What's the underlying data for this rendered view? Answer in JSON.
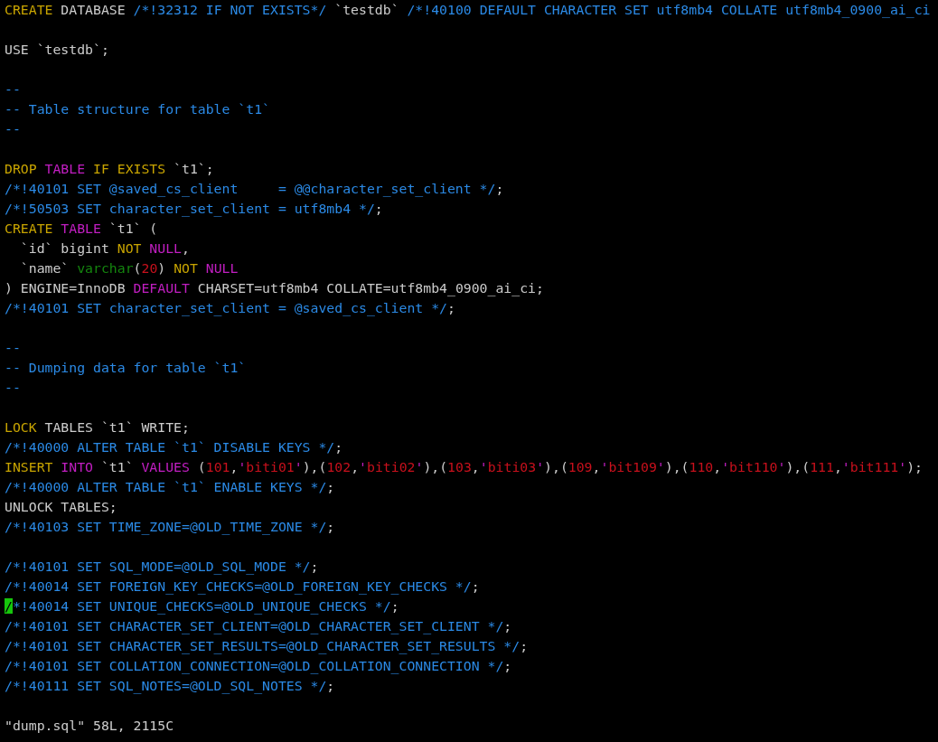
{
  "blocks": [
    [
      [
        {
          "text": "CREATE",
          "kind": "keyword"
        },
        {
          "text": " DATABASE ",
          "kind": "plain"
        },
        {
          "text": "/*!32312 IF NOT EXISTS*/",
          "kind": "comment"
        },
        {
          "text": " `testdb` ",
          "kind": "plain"
        },
        {
          "text": "/*!40100 DEFAULT CHARACTER SET utf8mb4 COLLATE utf8mb4_0900_ai_ci",
          "kind": "comment"
        }
      ]
    ],
    [
      [
        {
          "text": "USE `testdb`;",
          "kind": "plain"
        }
      ]
    ],
    [
      [
        {
          "text": "--",
          "kind": "comment"
        }
      ],
      [
        {
          "text": "-- Table structure for table `t1`",
          "kind": "comment"
        }
      ],
      [
        {
          "text": "--",
          "kind": "comment"
        }
      ]
    ],
    [
      [
        {
          "text": "DROP ",
          "kind": "keyword"
        },
        {
          "text": "TABLE ",
          "kind": "statement"
        },
        {
          "text": "IF EXISTS",
          "kind": "keyword"
        },
        {
          "text": " `t1`;",
          "kind": "plain"
        }
      ],
      [
        {
          "text": "/*!40101 SET @saved_cs_client     = @@character_set_client */",
          "kind": "comment"
        },
        {
          "text": ";",
          "kind": "plain"
        }
      ],
      [
        {
          "text": "/*!50503 SET character_set_client = utf8mb4 */",
          "kind": "comment"
        },
        {
          "text": ";",
          "kind": "plain"
        }
      ],
      [
        {
          "text": "CREATE ",
          "kind": "keyword"
        },
        {
          "text": "TABLE",
          "kind": "statement"
        },
        {
          "text": " `t1` (",
          "kind": "plain"
        }
      ],
      [
        {
          "text": "  `id` bigint ",
          "kind": "plain"
        },
        {
          "text": "NOT ",
          "kind": "keyword"
        },
        {
          "text": "NULL",
          "kind": "statement"
        },
        {
          "text": ",",
          "kind": "plain"
        }
      ],
      [
        {
          "text": "  `name` ",
          "kind": "plain"
        },
        {
          "text": "varchar",
          "kind": "type"
        },
        {
          "text": "(",
          "kind": "plain"
        },
        {
          "text": "20",
          "kind": "number"
        },
        {
          "text": ") ",
          "kind": "plain"
        },
        {
          "text": "NOT ",
          "kind": "keyword"
        },
        {
          "text": "NULL",
          "kind": "statement"
        }
      ],
      [
        {
          "text": ") ENGINE=InnoDB ",
          "kind": "plain"
        },
        {
          "text": "DEFAULT",
          "kind": "statement"
        },
        {
          "text": " CHARSET=utf8mb4 COLLATE=utf8mb4_0900_ai_ci;",
          "kind": "plain"
        }
      ],
      [
        {
          "text": "/*!40101 SET character_set_client = @saved_cs_client */",
          "kind": "comment"
        },
        {
          "text": ";",
          "kind": "plain"
        }
      ]
    ],
    [
      [
        {
          "text": "--",
          "kind": "comment"
        }
      ],
      [
        {
          "text": "-- Dumping data for table `t1`",
          "kind": "comment"
        }
      ],
      [
        {
          "text": "--",
          "kind": "comment"
        }
      ]
    ],
    [
      [
        {
          "text": "LOCK",
          "kind": "keyword"
        },
        {
          "text": " TABLES `t1` WRITE;",
          "kind": "plain"
        }
      ],
      [
        {
          "text": "/*!40000 ALTER TABLE `t1` DISABLE KEYS */",
          "kind": "comment"
        },
        {
          "text": ";",
          "kind": "plain"
        }
      ],
      [
        {
          "text": "INSERT ",
          "kind": "keyword"
        },
        {
          "text": "INTO",
          "kind": "statement"
        },
        {
          "text": " `t1` ",
          "kind": "plain"
        },
        {
          "text": "VALUES",
          "kind": "statement"
        },
        {
          "text": " (",
          "kind": "plain"
        },
        {
          "text": "101",
          "kind": "number"
        },
        {
          "text": ",",
          "kind": "plain"
        },
        {
          "text": "'",
          "kind": "statement"
        },
        {
          "text": "biti01",
          "kind": "string"
        },
        {
          "text": "'",
          "kind": "statement"
        },
        {
          "text": "),(",
          "kind": "plain"
        },
        {
          "text": "102",
          "kind": "number"
        },
        {
          "text": ",",
          "kind": "plain"
        },
        {
          "text": "'",
          "kind": "statement"
        },
        {
          "text": "biti02",
          "kind": "string"
        },
        {
          "text": "'",
          "kind": "statement"
        },
        {
          "text": "),(",
          "kind": "plain"
        },
        {
          "text": "103",
          "kind": "number"
        },
        {
          "text": ",",
          "kind": "plain"
        },
        {
          "text": "'",
          "kind": "statement"
        },
        {
          "text": "biti03",
          "kind": "string"
        },
        {
          "text": "'",
          "kind": "statement"
        },
        {
          "text": "),(",
          "kind": "plain"
        },
        {
          "text": "109",
          "kind": "number"
        },
        {
          "text": ",",
          "kind": "plain"
        },
        {
          "text": "'",
          "kind": "statement"
        },
        {
          "text": "bit109",
          "kind": "string"
        },
        {
          "text": "'",
          "kind": "statement"
        },
        {
          "text": "),(",
          "kind": "plain"
        },
        {
          "text": "110",
          "kind": "number"
        },
        {
          "text": ",",
          "kind": "plain"
        },
        {
          "text": "'",
          "kind": "statement"
        },
        {
          "text": "bit110",
          "kind": "string"
        },
        {
          "text": "'",
          "kind": "statement"
        },
        {
          "text": "),(",
          "kind": "plain"
        },
        {
          "text": "111",
          "kind": "number"
        },
        {
          "text": ",",
          "kind": "plain"
        },
        {
          "text": "'",
          "kind": "statement"
        },
        {
          "text": "bit111",
          "kind": "string"
        },
        {
          "text": "'",
          "kind": "statement"
        },
        {
          "text": ");",
          "kind": "plain"
        }
      ],
      [
        {
          "text": "/*!40000 ALTER TABLE `t1` ENABLE KEYS */",
          "kind": "comment"
        },
        {
          "text": ";",
          "kind": "plain"
        }
      ],
      [
        {
          "text": "UNLOCK TABLES;",
          "kind": "plain"
        }
      ],
      [
        {
          "text": "/*!40103 SET TIME_ZONE=@OLD_TIME_ZONE */",
          "kind": "comment"
        },
        {
          "text": ";",
          "kind": "plain"
        }
      ]
    ],
    [
      [
        {
          "text": "/*!40101 SET SQL_MODE=@OLD_SQL_MODE */",
          "kind": "comment"
        },
        {
          "text": ";",
          "kind": "plain"
        }
      ],
      [
        {
          "text": "/*!40014 SET FOREIGN_KEY_CHECKS=@OLD_FOREIGN_KEY_CHECKS */",
          "kind": "comment"
        },
        {
          "text": ";",
          "kind": "plain"
        }
      ],
      [
        {
          "text": "/",
          "kind": "cursor"
        },
        {
          "text": "*!40014 SET UNIQUE_CHECKS=@OLD_UNIQUE_CHECKS */",
          "kind": "comment"
        },
        {
          "text": ";",
          "kind": "plain"
        }
      ],
      [
        {
          "text": "/*!40101 SET CHARACTER_SET_CLIENT=@OLD_CHARACTER_SET_CLIENT */",
          "kind": "comment"
        },
        {
          "text": ";",
          "kind": "plain"
        }
      ],
      [
        {
          "text": "/*!40101 SET CHARACTER_SET_RESULTS=@OLD_CHARACTER_SET_RESULTS */",
          "kind": "comment"
        },
        {
          "text": ";",
          "kind": "plain"
        }
      ],
      [
        {
          "text": "/*!40101 SET COLLATION_CONNECTION=@OLD_COLLATION_CONNECTION */",
          "kind": "comment"
        },
        {
          "text": ";",
          "kind": "plain"
        }
      ],
      [
        {
          "text": "/*!40111 SET SQL_NOTES=@OLD_SQL_NOTES */",
          "kind": "comment"
        },
        {
          "text": ";",
          "kind": "plain"
        }
      ]
    ]
  ],
  "status_line": "\"dump.sql\" 58L, 2115C"
}
